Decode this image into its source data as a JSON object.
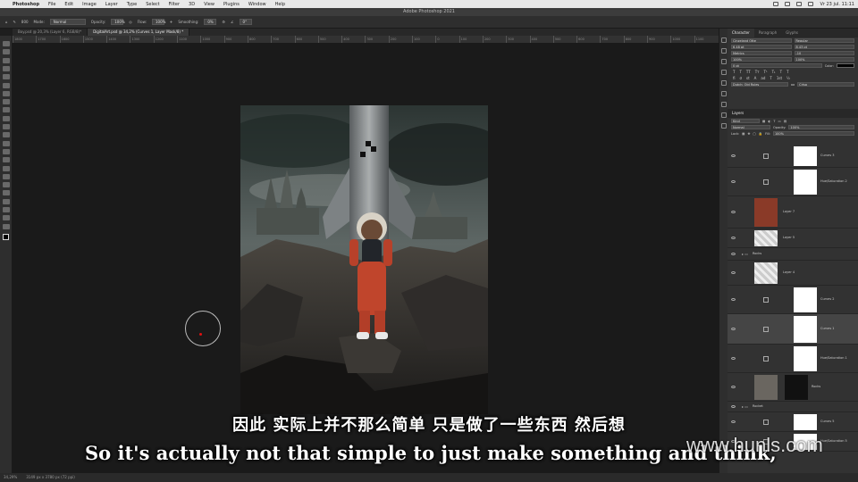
{
  "menubar": {
    "app": "Photoshop",
    "items": [
      "File",
      "Edit",
      "Image",
      "Layer",
      "Type",
      "Select",
      "Filter",
      "3D",
      "View",
      "Plugins",
      "Window",
      "Help"
    ],
    "clock": "Vr 23 jul. 11:11"
  },
  "window_title": "Adobe Photoshop 2021",
  "options": {
    "mode_label": "Mode:",
    "mode": "Normal",
    "opacity_label": "Opacity:",
    "opacity": "100%",
    "flow_label": "Flow:",
    "flow": "100%",
    "smoothing_label": "Smoothing:",
    "smoothing": "0%",
    "angle": "0°",
    "brush_size": "800"
  },
  "doc_tabs": [
    "Boy.psd @ 20,3% (Layer 6, RGB/8)*",
    "DigitalArt.psd @ 34,2% (Curves 1, Layer Mask/8) *"
  ],
  "ruler_ticks": [
    "1800",
    "1700",
    "1600",
    "1500",
    "1400",
    "1300",
    "1200",
    "1100",
    "1000",
    "900",
    "800",
    "700",
    "600",
    "500",
    "400",
    "300",
    "200",
    "100",
    "0",
    "100",
    "200",
    "300",
    "400",
    "500",
    "600",
    "700",
    "800",
    "900",
    "1000",
    "1100"
  ],
  "status": {
    "zoom": "34,29%",
    "size": "3149 px x 3780 px (72 ppi)"
  },
  "character_panel": {
    "tabs": [
      "Character",
      "Paragraph",
      "Glyphs"
    ],
    "font": "Cinzeland Otte",
    "style": "Regular",
    "size": "6,48 pt",
    "leading": "8,43 pt",
    "kerning": "Metrics",
    "tracking": "-10",
    "vscale": "100%",
    "hscale": "100%",
    "baseline": "0 pt",
    "color_label": "Color:",
    "language": "Dutch: Old Rules",
    "aa_label": "aa",
    "aa": "Crisp"
  },
  "layers_panel": {
    "title": "Layers",
    "filter": "Kind",
    "blend": "Normal",
    "opacity_label": "Opacity:",
    "opacity": "100%",
    "lock_label": "Lock:",
    "fill_label": "Fill:",
    "fill": "100%",
    "layers": [
      {
        "name": "Curves 3",
        "kind": "adj"
      },
      {
        "name": "Hue/Saturation 2",
        "kind": "adj"
      },
      {
        "name": "Layer 7",
        "kind": "img"
      },
      {
        "name": "Layer 5",
        "kind": "img"
      },
      {
        "name": "Rocks",
        "kind": "group"
      },
      {
        "name": "Layer 4",
        "kind": "img"
      },
      {
        "name": "Curves 2",
        "kind": "adj"
      },
      {
        "name": "Curves 1",
        "kind": "adj",
        "selected": true
      },
      {
        "name": "Hue/Saturation 1",
        "kind": "adj"
      },
      {
        "name": "Rocks",
        "kind": "img"
      },
      {
        "name": "Rocket",
        "kind": "group"
      },
      {
        "name": "Curves 5",
        "kind": "adj"
      },
      {
        "name": "Hue/Saturation 5",
        "kind": "adj"
      }
    ]
  },
  "subtitles": {
    "zh": "因此 实际上并不那么简单 只是做了一些东西 然后想",
    "en": "So it's actually not that simple to just make something and think,"
  },
  "watermark": "www.hunls.com",
  "colors": {
    "brush_dot": "#e01010",
    "suit": "#c0452c"
  }
}
